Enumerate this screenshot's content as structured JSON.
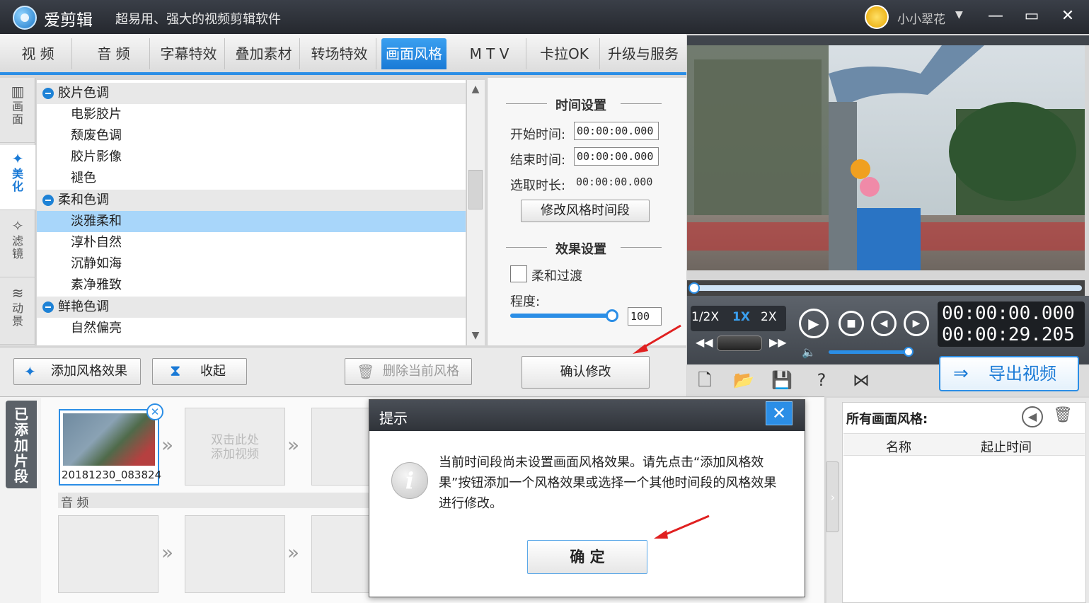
{
  "app": {
    "name": "爱剪辑",
    "slogan": "超易用、强大的视频剪辑软件",
    "user": "小小翠花"
  },
  "tabs": [
    "视 频",
    "音 频",
    "字幕特效",
    "叠加素材",
    "转场特效",
    "画面风格",
    "M T V",
    "卡拉OK",
    "升级与服务"
  ],
  "active_tab": "画面风格",
  "side_tabs": [
    {
      "label": "画面",
      "icon": "frame-icon"
    },
    {
      "label": "美化",
      "icon": "magic-wand-icon"
    },
    {
      "label": "滤镜",
      "icon": "filter-wand-icon"
    },
    {
      "label": "动景",
      "icon": "wave-icon"
    }
  ],
  "tree": [
    {
      "text": "胶片色调",
      "type": "category"
    },
    {
      "text": "电影胶片",
      "type": "item"
    },
    {
      "text": "颓废色调",
      "type": "item"
    },
    {
      "text": "胶片影像",
      "type": "item"
    },
    {
      "text": "褪色",
      "type": "item"
    },
    {
      "text": "柔和色调",
      "type": "category"
    },
    {
      "text": "淡雅柔和",
      "type": "item",
      "selected": true
    },
    {
      "text": "淳朴自然",
      "type": "item"
    },
    {
      "text": "沉静如海",
      "type": "item"
    },
    {
      "text": "素净雅致",
      "type": "item"
    },
    {
      "text": "鲜艳色调",
      "type": "category"
    },
    {
      "text": "自然偏亮",
      "type": "item"
    }
  ],
  "settings": {
    "time_header": "时间设置",
    "start_label": "开始时间:",
    "start_value": "00:00:00.000",
    "end_label": "结束时间:",
    "end_value": "00:00:00.000",
    "duration_label": "选取时长:",
    "duration_value": "00:00:00.000",
    "modify_time_btn": "修改风格时间段",
    "effect_header": "效果设置",
    "soft_transition": "柔和过渡",
    "degree_label": "程度:",
    "degree_value": "100",
    "degree_fraction": 1.0,
    "confirm_btn": "确认修改"
  },
  "buttons": {
    "add_style": "添加风格效果",
    "collapse": "收起",
    "delete_style": "删除当前风格"
  },
  "player": {
    "speeds": [
      "1/2X",
      "1X",
      "2X"
    ],
    "current_time": "00:00:00.000",
    "total_time": "00:00:29.205",
    "export_btn": "导出视频",
    "progress": 0.0,
    "volume": 0.85
  },
  "timeline": {
    "added_label": "已添加片段",
    "clip_name": "20181230_083824",
    "placeholder": "双击此处\n添加视频",
    "audio_label": "音 频"
  },
  "right_panel": {
    "title": "所有画面风格:",
    "col_name": "名称",
    "col_time": "起止时间"
  },
  "dialog": {
    "title": "提示",
    "message": "当前时间段尚未设置画面风格效果。请先点击“添加风格效果”按钮添加一个风格效果或选择一个其他时间段的风格效果进行修改。",
    "ok_btn": "确 定"
  },
  "colors": {
    "accent": "#1a7ad6",
    "active_tab": "#2b8ee6",
    "selected_row": "#a8d6fa",
    "player_bg": "#40454c"
  }
}
